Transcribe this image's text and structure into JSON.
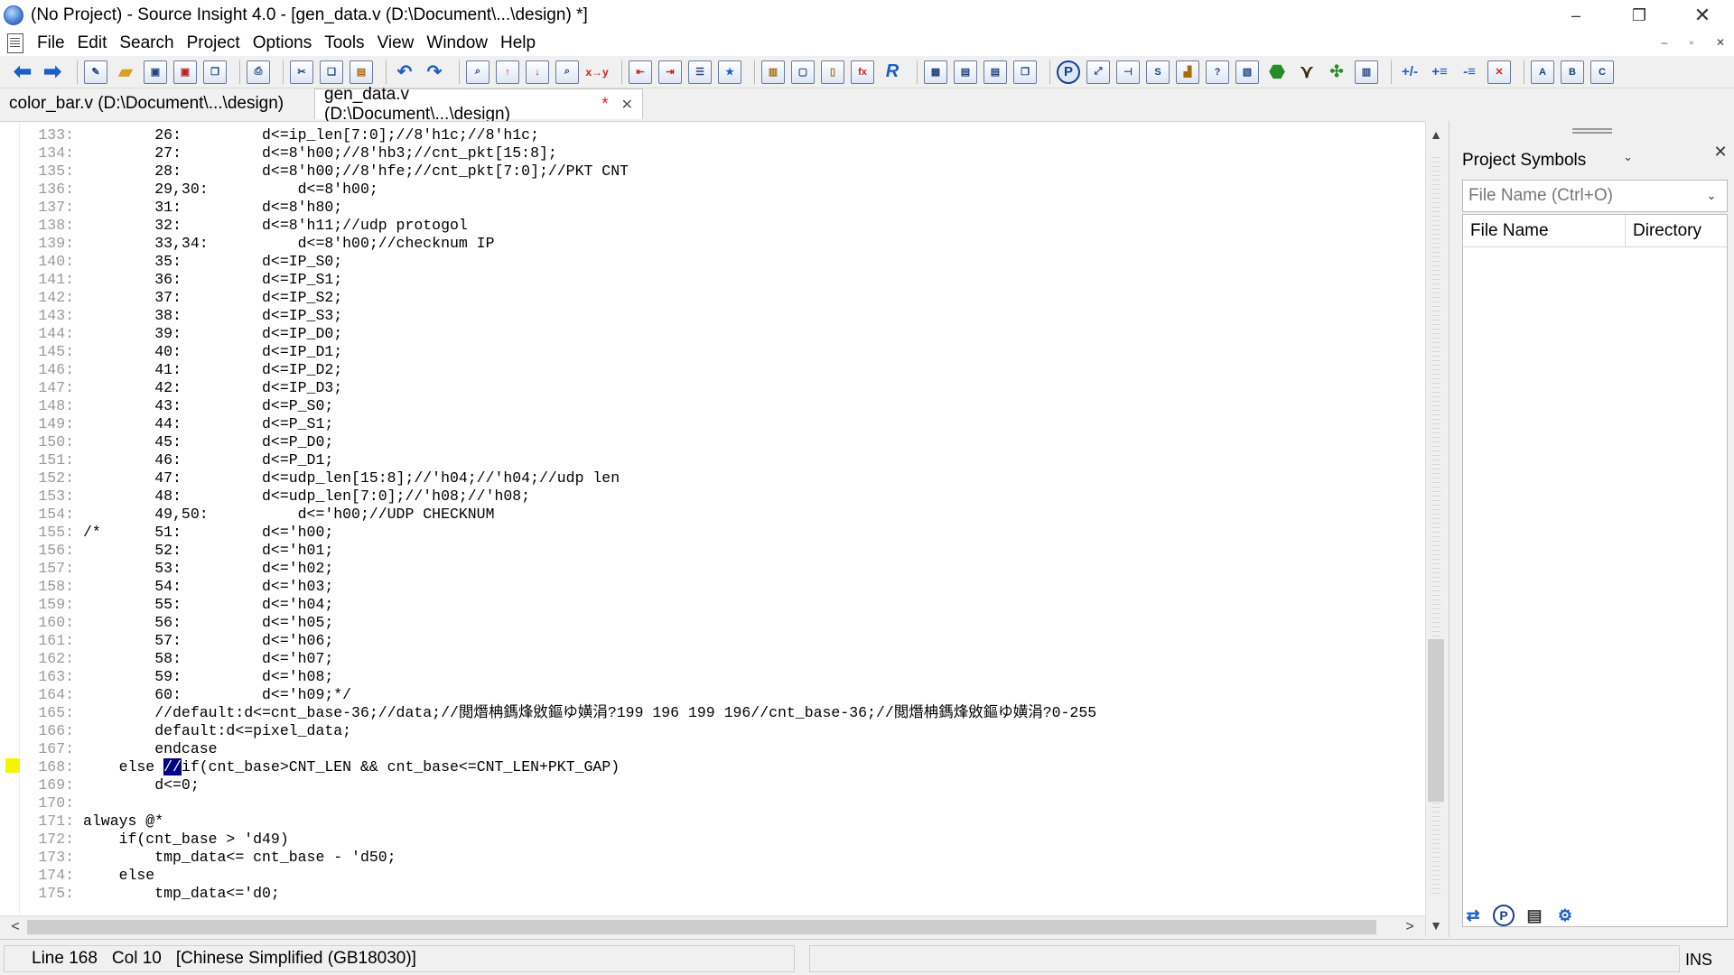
{
  "window": {
    "title": "(No Project) - Source Insight 4.0 - [gen_data.v (D:\\Document\\...\\design) *]",
    "minimize": "–",
    "restore": "❐",
    "close": "✕"
  },
  "menu": {
    "items": [
      "File",
      "Edit",
      "Search",
      "Project",
      "Options",
      "Tools",
      "View",
      "Window",
      "Help"
    ],
    "mdi_min": "–",
    "mdi_restore": "▫",
    "mdi_close": "✕"
  },
  "tabs": [
    {
      "label": "color_bar.v (D:\\Document\\...\\design)",
      "modified": "",
      "close": ""
    },
    {
      "label": "gen_data.v (D:\\Document\\...\\design)",
      "modified": "*",
      "close": "✕"
    }
  ],
  "code": {
    "lines": [
      {
        "num": "133:",
        "text": "        26:         d<=ip_len[7:0];//8'h1c;//8'h1c;"
      },
      {
        "num": "134:",
        "text": "        27:         d<=8'h00;//8'hb3;//cnt_pkt[15:8];"
      },
      {
        "num": "135:",
        "text": "        28:         d<=8'h00;//8'hfe;//cnt_pkt[7:0];//PKT CNT"
      },
      {
        "num": "136:",
        "text": "        29,30:          d<=8'h00;"
      },
      {
        "num": "137:",
        "text": "        31:         d<=8'h80;"
      },
      {
        "num": "138:",
        "text": "        32:         d<=8'h11;//udp protogol"
      },
      {
        "num": "139:",
        "text": "        33,34:          d<=8'h00;//checknum IP"
      },
      {
        "num": "140:",
        "text": "        35:         d<=IP_S0;"
      },
      {
        "num": "141:",
        "text": "        36:         d<=IP_S1;"
      },
      {
        "num": "142:",
        "text": "        37:         d<=IP_S2;"
      },
      {
        "num": "143:",
        "text": "        38:         d<=IP_S3;"
      },
      {
        "num": "144:",
        "text": "        39:         d<=IP_D0;"
      },
      {
        "num": "145:",
        "text": "        40:         d<=IP_D1;"
      },
      {
        "num": "146:",
        "text": "        41:         d<=IP_D2;"
      },
      {
        "num": "147:",
        "text": "        42:         d<=IP_D3;"
      },
      {
        "num": "148:",
        "text": "        43:         d<=P_S0;"
      },
      {
        "num": "149:",
        "text": "        44:         d<=P_S1;"
      },
      {
        "num": "150:",
        "text": "        45:         d<=P_D0;"
      },
      {
        "num": "151:",
        "text": "        46:         d<=P_D1;"
      },
      {
        "num": "152:",
        "text": "        47:         d<=udp_len[15:8];//'h04;//'h04;//udp len"
      },
      {
        "num": "153:",
        "text": "        48:         d<=udp_len[7:0];//'h08;//'h08;"
      },
      {
        "num": "154:",
        "text": "        49,50:          d<='h00;//UDP CHECKNUM"
      },
      {
        "num": "155:",
        "text": "/*      51:         d<='h00;"
      },
      {
        "num": "156:",
        "text": "        52:         d<='h01;"
      },
      {
        "num": "157:",
        "text": "        53:         d<='h02;"
      },
      {
        "num": "158:",
        "text": "        54:         d<='h03;"
      },
      {
        "num": "159:",
        "text": "        55:         d<='h04;"
      },
      {
        "num": "160:",
        "text": "        56:         d<='h05;"
      },
      {
        "num": "161:",
        "text": "        57:         d<='h06;"
      },
      {
        "num": "162:",
        "text": "        58:         d<='h07;"
      },
      {
        "num": "163:",
        "text": "        59:         d<='h08;"
      },
      {
        "num": "164:",
        "text": "        60:         d<='h09;*/"
      },
      {
        "num": "165:",
        "text": "        //default:d<=cnt_base-36;//data;//閲熸柟鎷烽敓鏂ゆ嫹涓?199 196 199 196//cnt_base-36;//閲熸柟鎷烽敓鏂ゆ嫹涓?0-255"
      },
      {
        "num": "166:",
        "text": "        default:d<=pixel_data;"
      },
      {
        "num": "167:",
        "text": "        endcase"
      },
      {
        "num": "168:",
        "text_pre": "    else ",
        "text_sel": "//",
        "text_post": "if(cnt_base>CNT_LEN && cnt_base<=CNT_LEN+PKT_GAP)"
      },
      {
        "num": "169:",
        "text": "        d<=0;"
      },
      {
        "num": "170:",
        "text": ""
      },
      {
        "num": "171:",
        "text": "always @*"
      },
      {
        "num": "172:",
        "text": "    if(cnt_base > 'd49)"
      },
      {
        "num": "173:",
        "text": "        tmp_data<= cnt_base - 'd50;"
      },
      {
        "num": "174:",
        "text": "    else"
      },
      {
        "num": "175:",
        "text": "        tmp_data<='d0;"
      }
    ]
  },
  "scrollbar": {
    "up": "▲",
    "down": "▼",
    "left": "<",
    "right": ">"
  },
  "side_panel": {
    "title": "Project Symbols",
    "close": "✕",
    "dropdown_arrow": "⌄",
    "search_placeholder": "File Name (Ctrl+O)",
    "columns": [
      "File Name",
      "Directory"
    ]
  },
  "status": {
    "line": "Line 168",
    "col": "Col 10",
    "encoding": "[Chinese Simplified (GB18030)]",
    "mode": "INS"
  },
  "colors": {
    "selection": "#000080",
    "bookmark": "#f5f500",
    "modified_star": "#e02020"
  }
}
